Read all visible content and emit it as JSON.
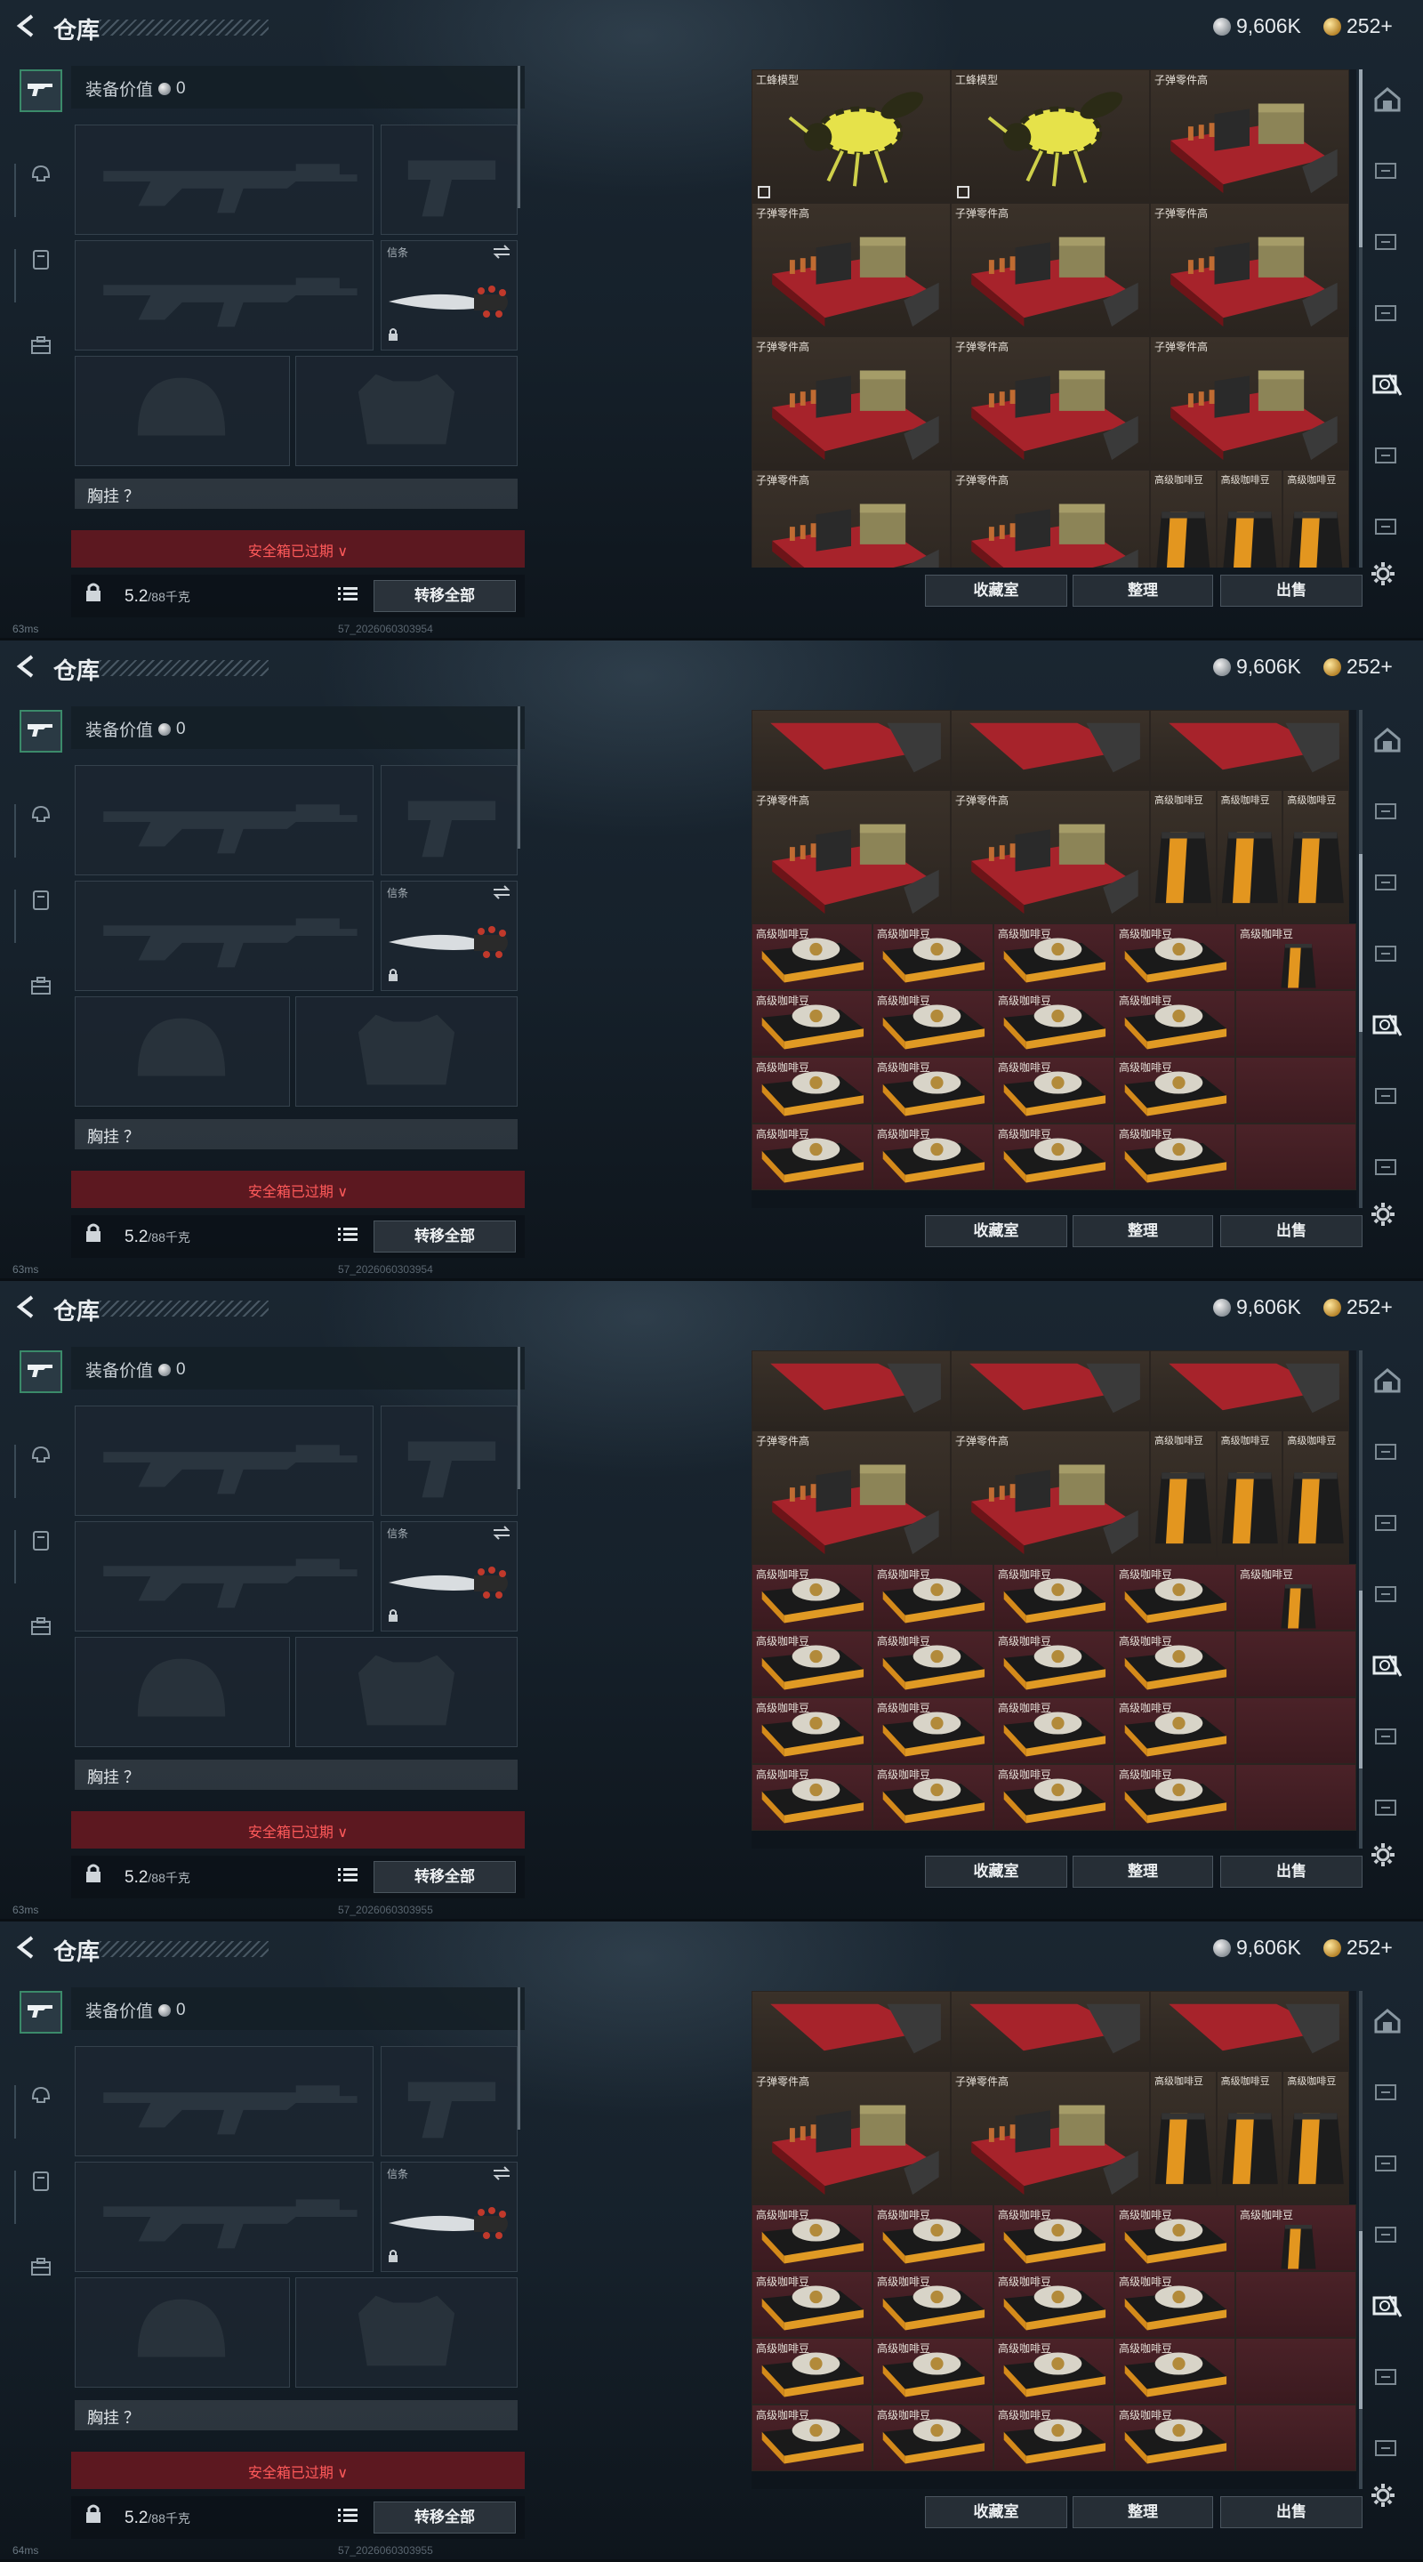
{
  "header": {
    "title": "仓库",
    "silver": "9,606K",
    "gold": "252+"
  },
  "equipment": {
    "value_label": "装备价值",
    "value": "0",
    "melee_label": "信条",
    "vest_label": "胸挂 ？",
    "safe_box_text": "安全箱已过期",
    "weight_value": "5.2",
    "weight_max": "/88千克",
    "transfer_all": "转移全部"
  },
  "actions": {
    "collection": "收藏室",
    "organize": "整理",
    "sell": "出售"
  },
  "frames": [
    {
      "status": "63ms",
      "build": "57_2026060303954"
    },
    {
      "status": "63ms",
      "build": "57_2026060303954"
    },
    {
      "status": "63ms",
      "build": "57_2026060303955"
    },
    {
      "status": "64ms",
      "build": "57_2026060303955"
    }
  ],
  "item_names": {
    "bee": "工蜂模型",
    "ammo": "子弹零件高",
    "coffee": "高级咖啡豆"
  },
  "grids": [
    {
      "rows": [
        [
          "bee",
          "bee",
          "ammo"
        ],
        [
          "ammo",
          "ammo",
          "ammo"
        ],
        [
          "ammo",
          "ammo",
          "ammo"
        ],
        [
          "ammo",
          "ammo",
          "coffee3"
        ]
      ],
      "scroll": 0.0
    },
    {
      "rows": [
        [
          "ammo_top",
          "ammo_top",
          "ammo_top"
        ],
        [
          "ammo",
          "ammo",
          "coffee3"
        ],
        [
          "beans5"
        ],
        [
          "beans5"
        ],
        [
          "beans5"
        ],
        [
          "beans5"
        ]
      ],
      "scroll": 0.45
    },
    {
      "rows": [
        [
          "ammo_top",
          "ammo_top",
          "ammo_top"
        ],
        [
          "ammo",
          "ammo",
          "coffee3"
        ],
        [
          "beans5"
        ],
        [
          "beans5"
        ],
        [
          "beans5"
        ],
        [
          "beans5"
        ]
      ],
      "scroll": 0.75
    },
    {
      "rows": [
        [
          "ammo_top",
          "ammo_top",
          "ammo_top"
        ],
        [
          "ammo",
          "ammo",
          "coffee3"
        ],
        [
          "beans5"
        ],
        [
          "beans5"
        ],
        [
          "beans5"
        ],
        [
          "beans5"
        ]
      ],
      "scroll": 0.75
    }
  ]
}
